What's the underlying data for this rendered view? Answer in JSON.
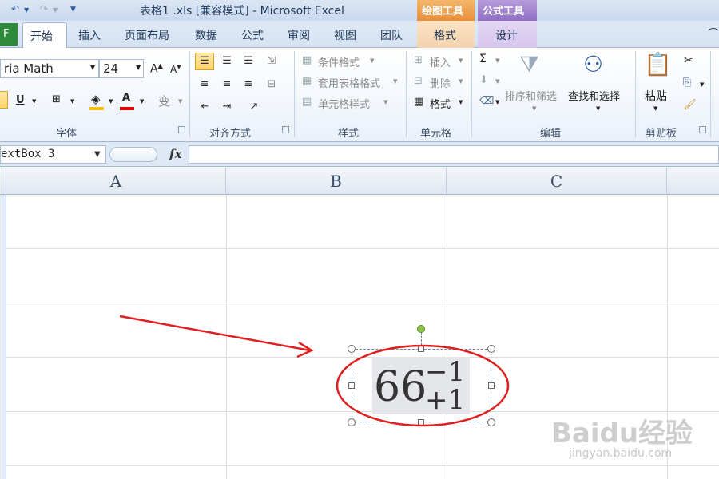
{
  "titlebar": {
    "title": "表格1 .xls  [兼容模式]  -  Microsoft Excel",
    "context_draw": "绘图工具",
    "context_formula": "公式工具"
  },
  "tabs": {
    "file": "F",
    "home": "开始",
    "insert": "插入",
    "page_layout": "页面布局",
    "data": "数据",
    "formulas": "公式",
    "review": "审阅",
    "view": "视图",
    "team": "团队",
    "format": "格式",
    "design": "设计"
  },
  "ribbon": {
    "font_name": "ria Math",
    "font_size": "24",
    "groups": {
      "font": "字体",
      "alignment": "对齐方式",
      "styles": "样式",
      "cells": "单元格",
      "editing": "编辑",
      "clipboard": "剪贴板"
    },
    "styles": {
      "conditional": "条件格式",
      "table_format": "套用表格格式",
      "cell_styles": "单元格样式"
    },
    "cells": {
      "insert": "插入",
      "delete": "删除",
      "format": "格式"
    },
    "editing": {
      "sort_filter": "排序和筛选",
      "find_select": "查找和选择"
    },
    "clipboard": {
      "paste": "粘贴"
    }
  },
  "formula_bar": {
    "name_box": "extBox 3",
    "fx": "fx",
    "formula": ""
  },
  "columns": [
    "A",
    "B",
    "C"
  ],
  "equation": {
    "base": "66",
    "superscript": "−1",
    "subscript": "+1"
  },
  "watermark": {
    "main": "Baidu经验",
    "url": "jingyan.baidu.com"
  },
  "colors": {
    "accent_ribbon": "#dfe9f5",
    "annotation_red": "#e02020",
    "file_tab": "#2d8a3a",
    "context_draw": "#e88f3a",
    "context_formula": "#8e6ec4"
  }
}
